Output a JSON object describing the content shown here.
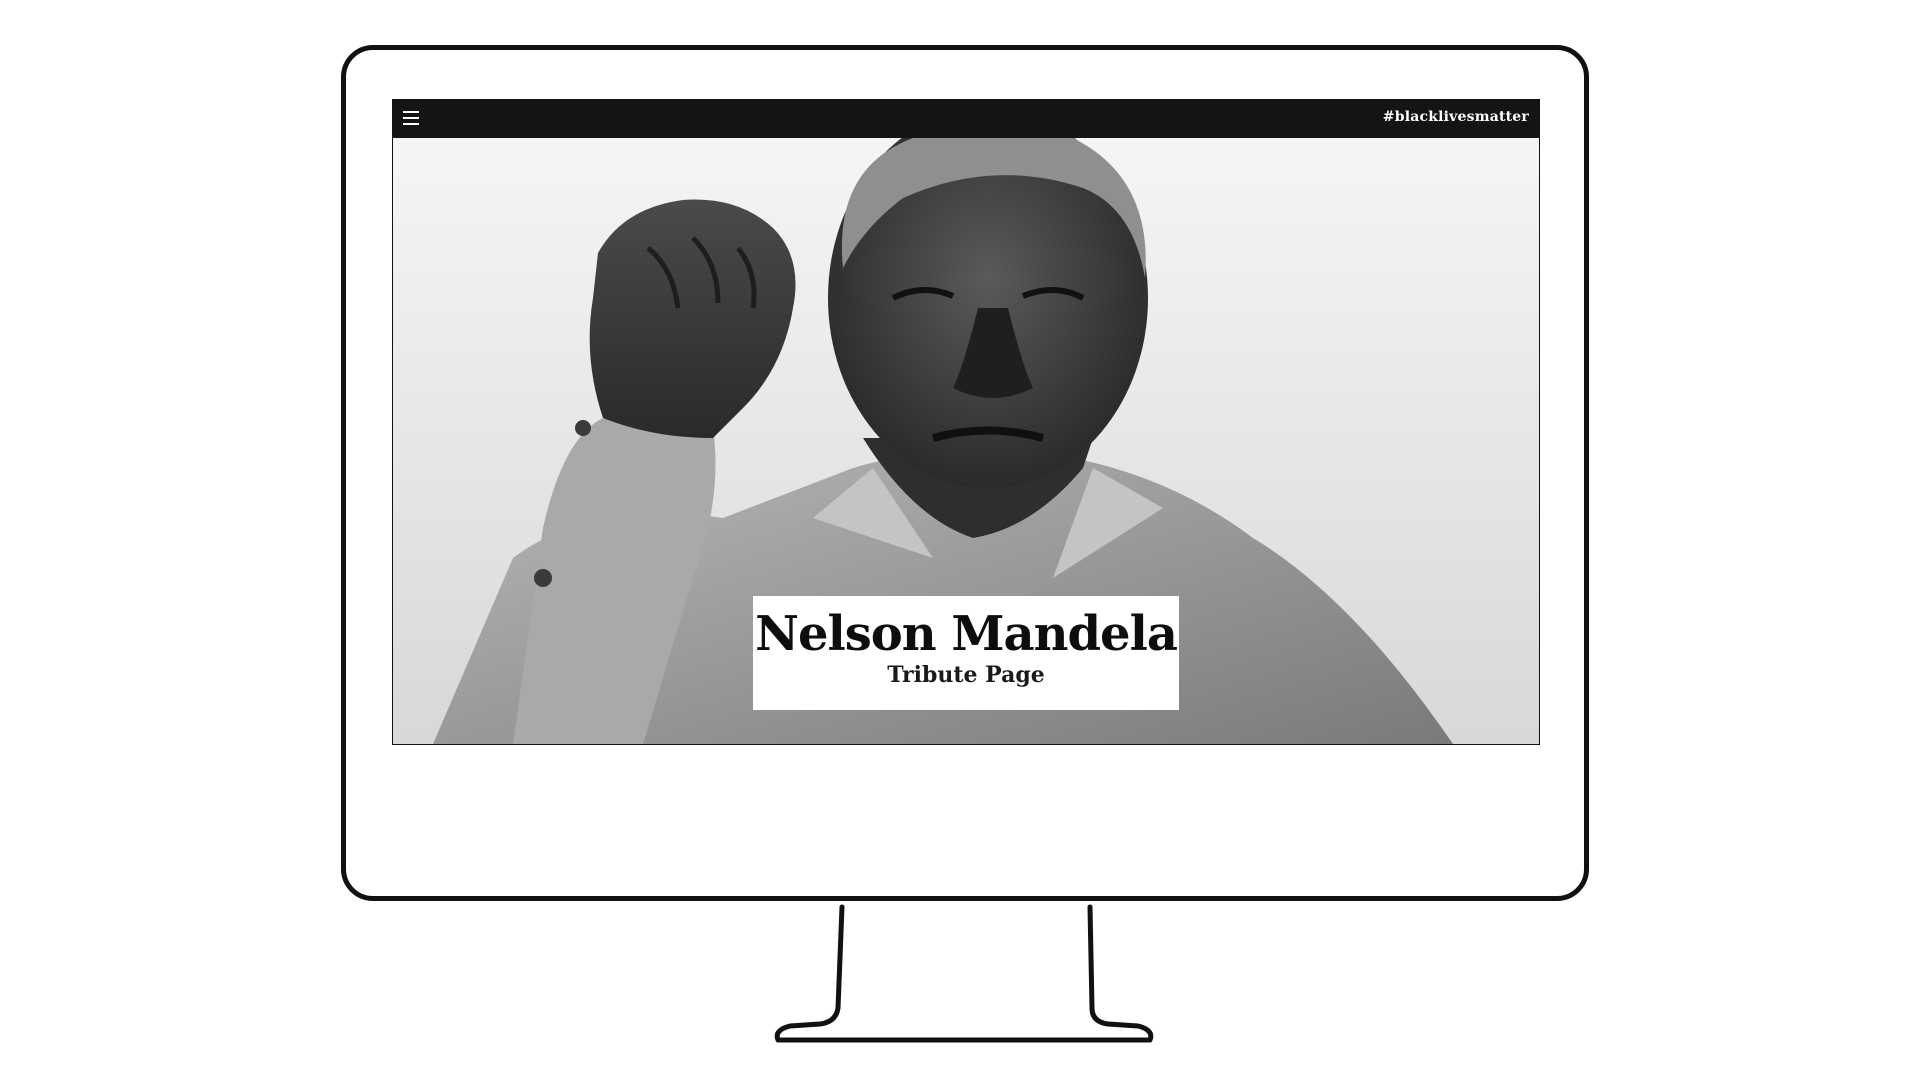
{
  "topbar": {
    "menu_icon": "hamburger-menu-icon",
    "hashtag": "#blacklivesmatter"
  },
  "hero": {
    "image": "black-and-white-portrait-raised-fist",
    "title": "Nelson Mandela",
    "subtitle": "Tribute Page"
  },
  "colors": {
    "topbar_bg": "#141414",
    "topbar_text": "#ffffff",
    "title_card_bg": "#ffffff",
    "title_text": "#0d0d0d"
  }
}
